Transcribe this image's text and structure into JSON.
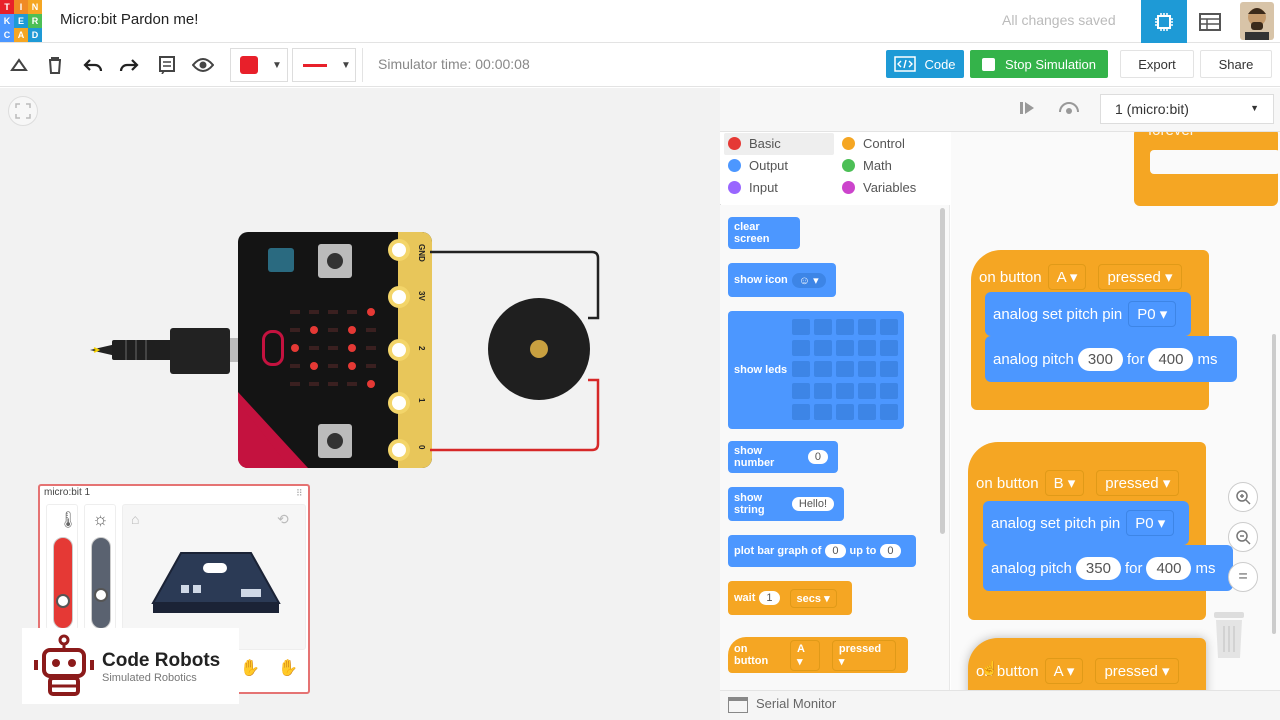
{
  "app": {
    "logo_letters": [
      "T",
      "I",
      "N",
      "K",
      "E",
      "R",
      "C",
      "A",
      "D"
    ],
    "title": "Micro:bit Pardon me!",
    "save_status": "All changes saved"
  },
  "toolbar": {
    "simulator_time": "Simulator time: 00:00:08",
    "code_label": "Code",
    "stop_label": "Stop Simulation",
    "export_label": "Export",
    "share_label": "Share",
    "color": "#e8202a"
  },
  "board": {
    "pin_labels": [
      "GND",
      "3V",
      "2",
      "1",
      "0"
    ]
  },
  "sensors": {
    "title": "micro:bit 1"
  },
  "brand": {
    "name": "Code Robots",
    "tagline": "Simulated Robotics"
  },
  "code_header": {
    "device": "1 (micro:bit)"
  },
  "categories": [
    {
      "label": "Basic",
      "color": "#e53935"
    },
    {
      "label": "Control",
      "color": "#f5a623"
    },
    {
      "label": "Output",
      "color": "#4c97ff"
    },
    {
      "label": "Math",
      "color": "#4cbf56"
    },
    {
      "label": "Input",
      "color": "#9966ff"
    },
    {
      "label": "Variables",
      "color": "#cc44cc"
    }
  ],
  "palette": {
    "clear_screen": "clear screen",
    "show_icon": "show icon",
    "show_leds": "show leds",
    "show_number": "show number",
    "show_number_val": "0",
    "show_string": "show string",
    "show_string_val": "Hello!",
    "plot_bar": "plot bar graph of",
    "plot_val": "0",
    "up_to": "up to",
    "up_to_val": "0",
    "wait": "wait",
    "wait_val": "1",
    "secs": "secs",
    "on_button": "on button",
    "btn_a": "A",
    "pressed": "pressed"
  },
  "workspace": {
    "forever": "forever",
    "block1": {
      "on": "on button",
      "btn": "A",
      "event": "pressed",
      "set_pitch": "analog set pitch pin",
      "pin": "P0",
      "pitch": "analog pitch",
      "freq": "300",
      "for": "for",
      "dur": "400",
      "ms": "ms"
    },
    "block2": {
      "on": "on button",
      "btn": "B",
      "event": "pressed",
      "set_pitch": "analog set pitch pin",
      "pin": "P0",
      "pitch": "analog pitch",
      "freq": "350",
      "for": "for",
      "dur": "400",
      "ms": "ms"
    },
    "block3": {
      "on": "on button",
      "btn": "A",
      "event": "pressed"
    }
  },
  "zoom": {
    "reset": "="
  },
  "serial": {
    "label": "Serial Monitor"
  }
}
